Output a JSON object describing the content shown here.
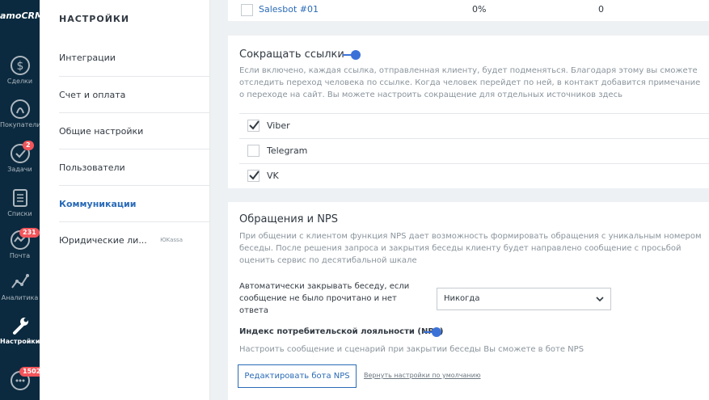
{
  "leftnav": {
    "logo": "amoCRM.",
    "items": [
      {
        "label": "Сделки",
        "icon": "dollar-icon"
      },
      {
        "label": "Покупатели",
        "icon": "customers-icon"
      },
      {
        "label": "Задачи",
        "icon": "tasks-check-icon",
        "badge": "2"
      },
      {
        "label": "Списки",
        "icon": "lists-icon"
      },
      {
        "label": "Почта",
        "icon": "mail-icon",
        "badge": "231"
      },
      {
        "label": "Аналитика",
        "icon": "analytics-icon"
      },
      {
        "label": "Настройки",
        "icon": "wrench-icon"
      },
      {
        "label": "",
        "icon": "chat-icon",
        "badge": "1502"
      }
    ]
  },
  "settings_menu": {
    "title": "НАСТРОЙКИ",
    "items": [
      {
        "label": "Интеграции"
      },
      {
        "label": "Счет и оплата"
      },
      {
        "label": "Общие настройки"
      },
      {
        "label": "Пользователи"
      },
      {
        "label": "Коммуникации"
      },
      {
        "label": "Юридические ли...",
        "tag": "ЮKassa"
      }
    ]
  },
  "table_row": {
    "name": "Salesbot #01",
    "col1": "0%",
    "col2": "0"
  },
  "shorten_links": {
    "title": "Сокращать ссылки",
    "enabled": true,
    "description": "Если включено, каждая ссылка, отправленная клиенту, будет подменяться. Благодаря этому вы сможете отследить переход человека по ссылке. Когда человек перейдет по ней, в контакт добавится примечание о переходе на сайт. Вы можете настроить сокращение для отдельных источников здесь",
    "sources": [
      {
        "label": "Viber",
        "checked": true
      },
      {
        "label": "Telegram",
        "checked": false
      },
      {
        "label": "VK",
        "checked": true
      }
    ]
  },
  "nps": {
    "title": "Обращения и NPS",
    "description": "При общении с клиентом функция NPS дает возможность формировать обращения с уникальным номером беседы. После решения запроса и закрытия беседы клиенту будет направлено сообщение с просьбой оценить сервис по десятибальной шкале",
    "autoclose_label": "Автоматически закрывать беседу, если сообщение не было прочитано и нет ответа",
    "autoclose_value": "Никогда",
    "index_title": "Индекс потребительской лояльности (NPS)",
    "index_enabled": true,
    "index_description": "Настроить сообщение и сценарий при закрытии беседы Вы сможете в боте NPS",
    "edit_button": "Редактировать бота NPS",
    "reset_link": "Вернуть настройки по умолчанию"
  },
  "colors": {
    "nav_bg": "#0b2a3f",
    "accent": "#2a6bb7",
    "toggle": "#3c72d8",
    "badge": "#f3555a"
  }
}
